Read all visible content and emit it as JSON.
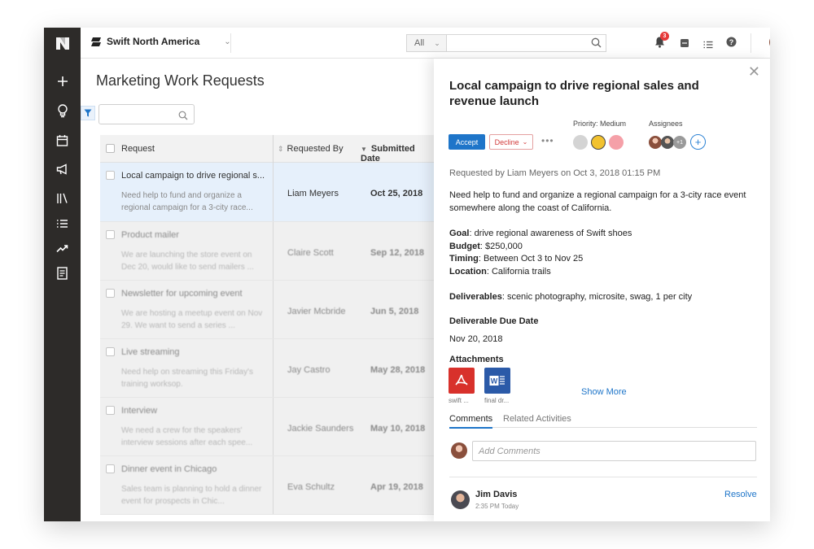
{
  "workspace": {
    "name": "Swift North America"
  },
  "topbar": {
    "filter_label": "All",
    "notification_count": "3",
    "icons": [
      "search-icon",
      "bell-icon",
      "inbox-icon",
      "list-icon",
      "help-icon",
      "avatar"
    ]
  },
  "rail": {
    "icons": [
      "logo-icon",
      "plus-icon",
      "lightbulb-icon",
      "calendar-icon",
      "megaphone-icon",
      "library-icon",
      "list-icon",
      "trending-icon",
      "document-icon"
    ]
  },
  "page": {
    "title": "Marketing Work Requests"
  },
  "table": {
    "headers": [
      "Request",
      "Requested By",
      "Submitted Date"
    ],
    "rows": [
      {
        "title": "Local campaign to drive regional s...",
        "desc": "Need help to fund and organize a regional campaign for a 3-city race...",
        "by": "Liam Meyers",
        "date": "Oct 25, 2018"
      },
      {
        "title": "Product mailer",
        "desc": "We are launching the store event on Dec 20, would like to send mailers ...",
        "by": "Claire Scott",
        "date": "Sep 12, 2018"
      },
      {
        "title": "Newsletter for upcoming event",
        "desc": "We are hosting a meetup event on Nov 29. We want to send a series ...",
        "by": "Javier Mcbride",
        "date": "Jun 5, 2018"
      },
      {
        "title": "Live streaming",
        "desc": "Need help on streaming this Friday's training worksop.",
        "by": "Jay Castro",
        "date": "May 28, 2018"
      },
      {
        "title": "Interview",
        "desc": "We need a crew for the speakers' interview sessions after each spee...",
        "by": "Jackie Saunders",
        "date": "May 10, 2018"
      },
      {
        "title": "Dinner event in Chicago",
        "desc": "Sales team is planning to hold a dinner event for prospects in Chic...",
        "by": "Eva Schultz",
        "date": "Apr 19, 2018"
      }
    ]
  },
  "detail": {
    "title": "Local campaign to drive regional sales and revenue launch",
    "accept": "Accept",
    "decline": "Decline",
    "more": "•••",
    "priority_label": "Priority: Medium",
    "priority_colors": [
      "#d4d4d4",
      "#f2c230",
      "#f5a0a8"
    ],
    "assignees_label": "Assignees",
    "assignee_extra": "+1",
    "add_assignee": "+",
    "meta": "Requested by Liam Meyers on Oct 3, 2018 01:15 PM",
    "intro": "Need help to fund and organize a regional campaign for a 3-city race event somewhere along the coast of California.",
    "goal_label": "Goal",
    "goal": ": drive regional awareness of Swift shoes",
    "budget_label": "Budget",
    "budget": ": $250,000",
    "timing_label": "Timing",
    "timing": ": Between Oct 3 to Nov 25",
    "location_label": "Location",
    "location": ": California trails",
    "deliverables_label": "Deliverables",
    "deliverables": ": scenic photography, microsite, swag, 1 per city",
    "due_label": "Deliverable Due Date",
    "due": "Nov 20, 2018",
    "attachments_label": "Attachments",
    "attachments": [
      {
        "name": "swift ...",
        "icon": "pdf-icon"
      },
      {
        "name": "final dr...",
        "icon": "word-icon"
      }
    ],
    "show_more": "Show More",
    "tabs": [
      "Comments",
      "Related Activities"
    ],
    "comment_placeholder": "Add Comments",
    "comment": {
      "author": "Jim Davis",
      "time": "2:35 PM Today",
      "action": "Resolve"
    }
  }
}
